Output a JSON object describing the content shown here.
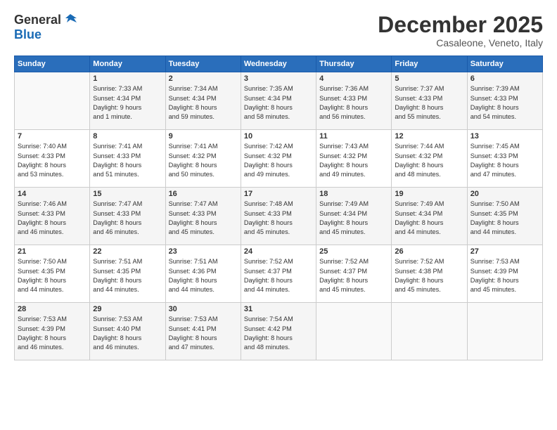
{
  "logo": {
    "general": "General",
    "blue": "Blue"
  },
  "title": "December 2025",
  "location": "Casaleone, Veneto, Italy",
  "days_header": [
    "Sunday",
    "Monday",
    "Tuesday",
    "Wednesday",
    "Thursday",
    "Friday",
    "Saturday"
  ],
  "weeks": [
    [
      {
        "day": "",
        "info": ""
      },
      {
        "day": "1",
        "info": "Sunrise: 7:33 AM\nSunset: 4:34 PM\nDaylight: 9 hours\nand 1 minute."
      },
      {
        "day": "2",
        "info": "Sunrise: 7:34 AM\nSunset: 4:34 PM\nDaylight: 8 hours\nand 59 minutes."
      },
      {
        "day": "3",
        "info": "Sunrise: 7:35 AM\nSunset: 4:34 PM\nDaylight: 8 hours\nand 58 minutes."
      },
      {
        "day": "4",
        "info": "Sunrise: 7:36 AM\nSunset: 4:33 PM\nDaylight: 8 hours\nand 56 minutes."
      },
      {
        "day": "5",
        "info": "Sunrise: 7:37 AM\nSunset: 4:33 PM\nDaylight: 8 hours\nand 55 minutes."
      },
      {
        "day": "6",
        "info": "Sunrise: 7:39 AM\nSunset: 4:33 PM\nDaylight: 8 hours\nand 54 minutes."
      }
    ],
    [
      {
        "day": "7",
        "info": "Sunrise: 7:40 AM\nSunset: 4:33 PM\nDaylight: 8 hours\nand 53 minutes."
      },
      {
        "day": "8",
        "info": "Sunrise: 7:41 AM\nSunset: 4:33 PM\nDaylight: 8 hours\nand 51 minutes."
      },
      {
        "day": "9",
        "info": "Sunrise: 7:41 AM\nSunset: 4:32 PM\nDaylight: 8 hours\nand 50 minutes."
      },
      {
        "day": "10",
        "info": "Sunrise: 7:42 AM\nSunset: 4:32 PM\nDaylight: 8 hours\nand 49 minutes."
      },
      {
        "day": "11",
        "info": "Sunrise: 7:43 AM\nSunset: 4:32 PM\nDaylight: 8 hours\nand 49 minutes."
      },
      {
        "day": "12",
        "info": "Sunrise: 7:44 AM\nSunset: 4:32 PM\nDaylight: 8 hours\nand 48 minutes."
      },
      {
        "day": "13",
        "info": "Sunrise: 7:45 AM\nSunset: 4:33 PM\nDaylight: 8 hours\nand 47 minutes."
      }
    ],
    [
      {
        "day": "14",
        "info": "Sunrise: 7:46 AM\nSunset: 4:33 PM\nDaylight: 8 hours\nand 46 minutes."
      },
      {
        "day": "15",
        "info": "Sunrise: 7:47 AM\nSunset: 4:33 PM\nDaylight: 8 hours\nand 46 minutes."
      },
      {
        "day": "16",
        "info": "Sunrise: 7:47 AM\nSunset: 4:33 PM\nDaylight: 8 hours\nand 45 minutes."
      },
      {
        "day": "17",
        "info": "Sunrise: 7:48 AM\nSunset: 4:33 PM\nDaylight: 8 hours\nand 45 minutes."
      },
      {
        "day": "18",
        "info": "Sunrise: 7:49 AM\nSunset: 4:34 PM\nDaylight: 8 hours\nand 45 minutes."
      },
      {
        "day": "19",
        "info": "Sunrise: 7:49 AM\nSunset: 4:34 PM\nDaylight: 8 hours\nand 44 minutes."
      },
      {
        "day": "20",
        "info": "Sunrise: 7:50 AM\nSunset: 4:35 PM\nDaylight: 8 hours\nand 44 minutes."
      }
    ],
    [
      {
        "day": "21",
        "info": "Sunrise: 7:50 AM\nSunset: 4:35 PM\nDaylight: 8 hours\nand 44 minutes."
      },
      {
        "day": "22",
        "info": "Sunrise: 7:51 AM\nSunset: 4:35 PM\nDaylight: 8 hours\nand 44 minutes."
      },
      {
        "day": "23",
        "info": "Sunrise: 7:51 AM\nSunset: 4:36 PM\nDaylight: 8 hours\nand 44 minutes."
      },
      {
        "day": "24",
        "info": "Sunrise: 7:52 AM\nSunset: 4:37 PM\nDaylight: 8 hours\nand 44 minutes."
      },
      {
        "day": "25",
        "info": "Sunrise: 7:52 AM\nSunset: 4:37 PM\nDaylight: 8 hours\nand 45 minutes."
      },
      {
        "day": "26",
        "info": "Sunrise: 7:52 AM\nSunset: 4:38 PM\nDaylight: 8 hours\nand 45 minutes."
      },
      {
        "day": "27",
        "info": "Sunrise: 7:53 AM\nSunset: 4:39 PM\nDaylight: 8 hours\nand 45 minutes."
      }
    ],
    [
      {
        "day": "28",
        "info": "Sunrise: 7:53 AM\nSunset: 4:39 PM\nDaylight: 8 hours\nand 46 minutes."
      },
      {
        "day": "29",
        "info": "Sunrise: 7:53 AM\nSunset: 4:40 PM\nDaylight: 8 hours\nand 46 minutes."
      },
      {
        "day": "30",
        "info": "Sunrise: 7:53 AM\nSunset: 4:41 PM\nDaylight: 8 hours\nand 47 minutes."
      },
      {
        "day": "31",
        "info": "Sunrise: 7:54 AM\nSunset: 4:42 PM\nDaylight: 8 hours\nand 48 minutes."
      },
      {
        "day": "",
        "info": ""
      },
      {
        "day": "",
        "info": ""
      },
      {
        "day": "",
        "info": ""
      }
    ]
  ]
}
